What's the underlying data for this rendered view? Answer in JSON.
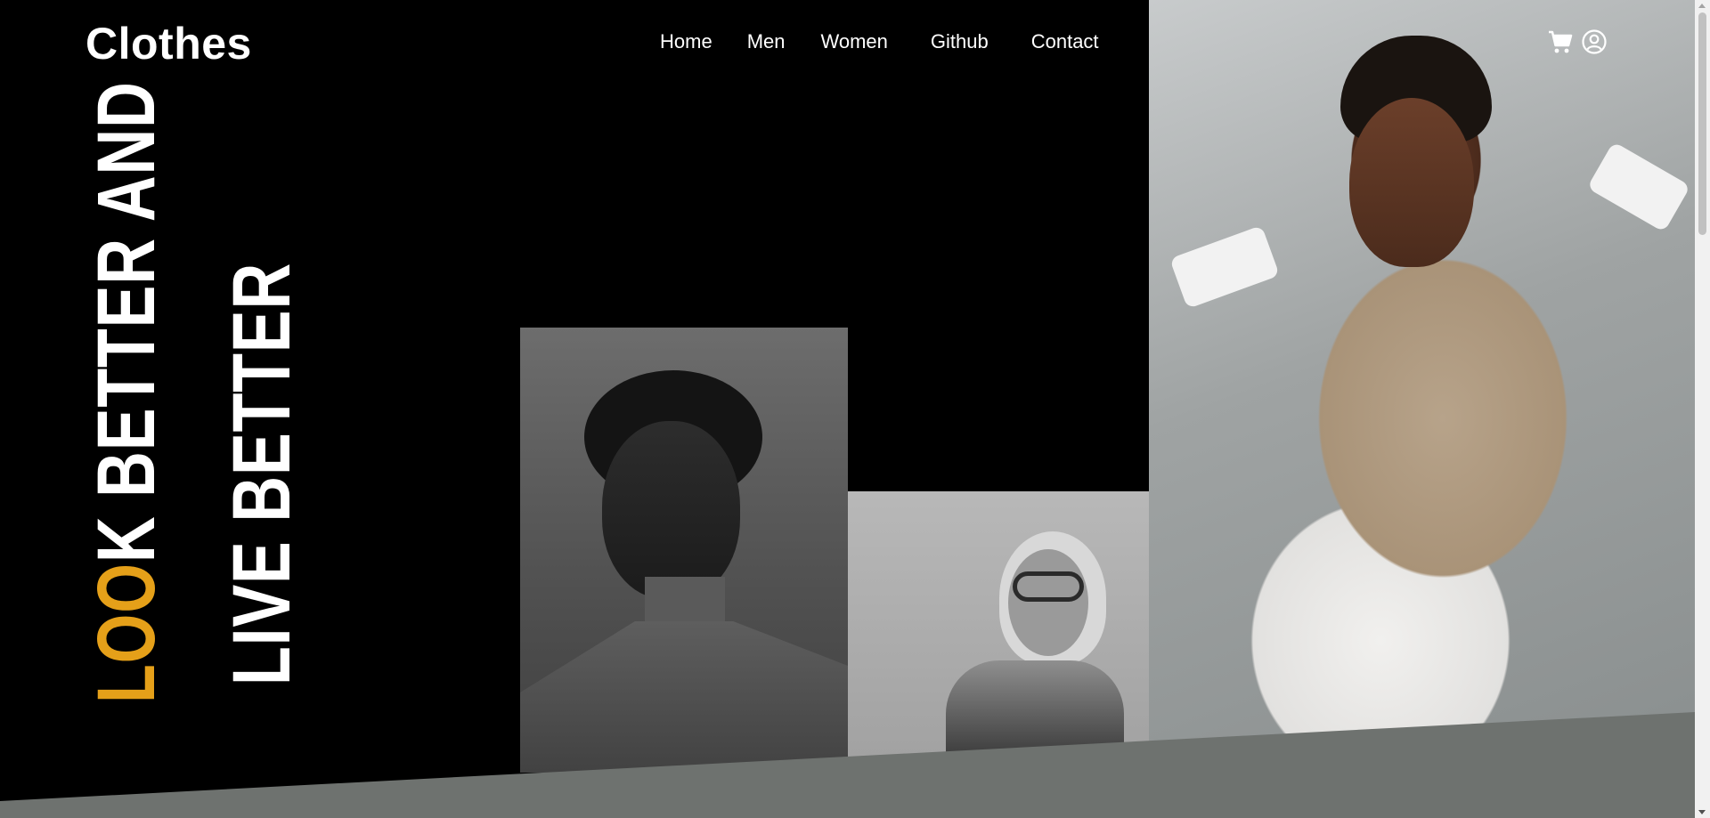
{
  "brand": {
    "logo": "Clothes"
  },
  "nav": {
    "items": [
      {
        "label": "Home"
      },
      {
        "label": "Men"
      },
      {
        "label": "Women"
      },
      {
        "label": "Github"
      },
      {
        "label": "Contact"
      }
    ]
  },
  "header_icons": [
    "cart-icon",
    "user-circle-icon"
  ],
  "hero": {
    "line1_accent": "LOO",
    "line1_rest": "K BETTER AND",
    "line2": "LIVE BETTER"
  },
  "colors": {
    "background": "#000000",
    "accent": "#e5a019",
    "band": "#6e726f",
    "text": "#ffffff"
  }
}
